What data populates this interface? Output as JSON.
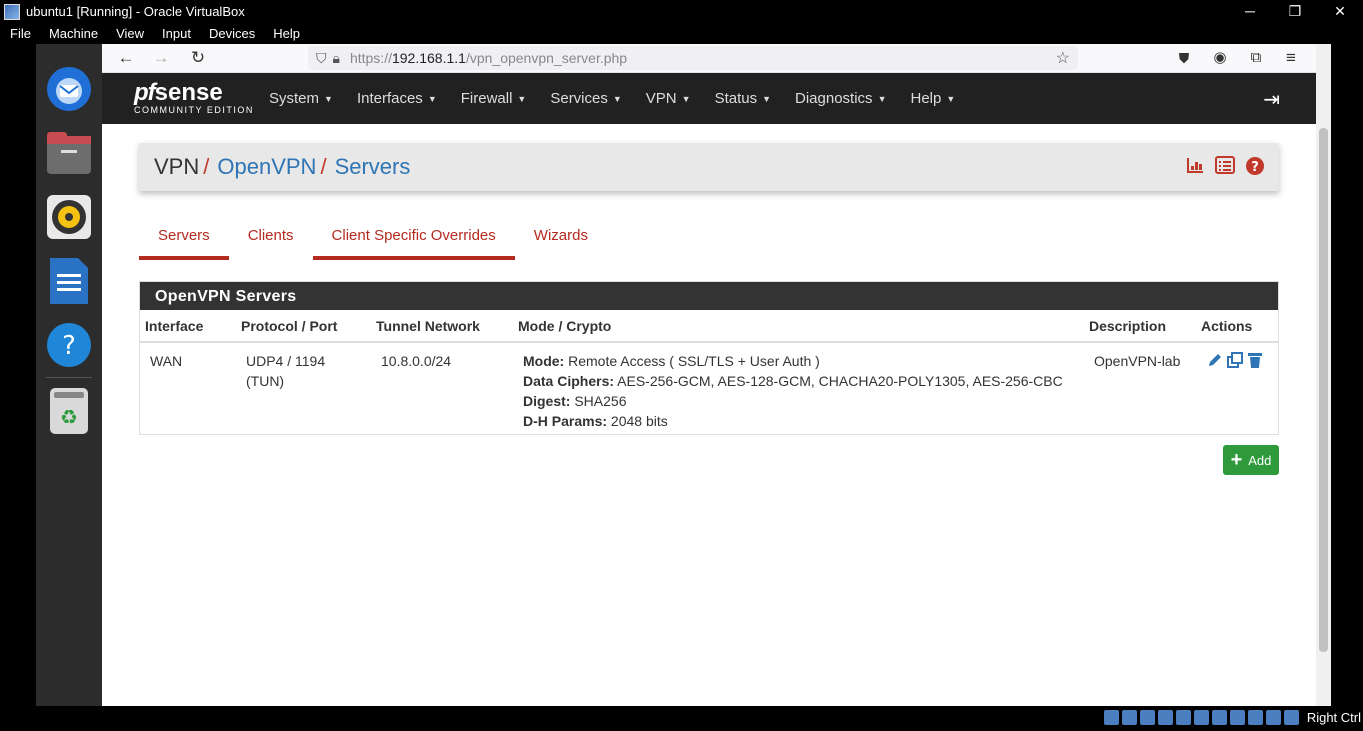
{
  "window": {
    "title": "ubuntu1 [Running] - Oracle VirtualBox",
    "controls": {
      "minimize": "─",
      "restore": "❐",
      "close": "✕"
    }
  },
  "vbox_menu": [
    "File",
    "Machine",
    "View",
    "Input",
    "Devices",
    "Help"
  ],
  "dock": {
    "apps": [
      "thunderbird-icon",
      "files-icon",
      "rhythmbox-icon",
      "writer-icon",
      "help-icon",
      "trash-icon"
    ]
  },
  "browser": {
    "url_prefix": "https://",
    "url_host": "192.168.1.1",
    "url_path": "/vpn_openvpn_server.php"
  },
  "pfsense": {
    "logo_pf": "pf",
    "logo_sense": "sense",
    "logo_edition": "COMMUNITY EDITION",
    "menu": [
      "System",
      "Interfaces",
      "Firewall",
      "Services",
      "VPN",
      "Status",
      "Diagnostics",
      "Help"
    ],
    "breadcrumb": [
      "VPN",
      "OpenVPN",
      "Servers"
    ],
    "breadcrumb_sep": "/",
    "tabs": [
      "Servers",
      "Clients",
      "Client Specific Overrides",
      "Wizards"
    ],
    "panel_title": "OpenVPN Servers",
    "table": {
      "headers": [
        "Interface",
        "Protocol / Port",
        "Tunnel Network",
        "Mode / Crypto",
        "Description",
        "Actions"
      ],
      "rows": [
        {
          "interface": "WAN",
          "protocol_line1": "UDP4 / 1194",
          "protocol_line2": "(TUN)",
          "tunnel_network": "10.8.0.0/24",
          "mode_label": "Mode:",
          "mode_value": "Remote Access ( SSL/TLS + User Auth )",
          "ciphers_label": "Data Ciphers:",
          "ciphers_value": "AES-256-GCM, AES-128-GCM, CHACHA20-POLY1305, AES-256-CBC",
          "digest_label": "Digest:",
          "digest_value": "SHA256",
          "dh_label": "D-H Params:",
          "dh_value": "2048 bits",
          "description": "OpenVPN-lab"
        }
      ]
    },
    "add_button": "Add",
    "accent_color": "#b52a1f",
    "link_color": "#2f75b5"
  },
  "statusbar": {
    "host_key": "Right Ctrl"
  }
}
